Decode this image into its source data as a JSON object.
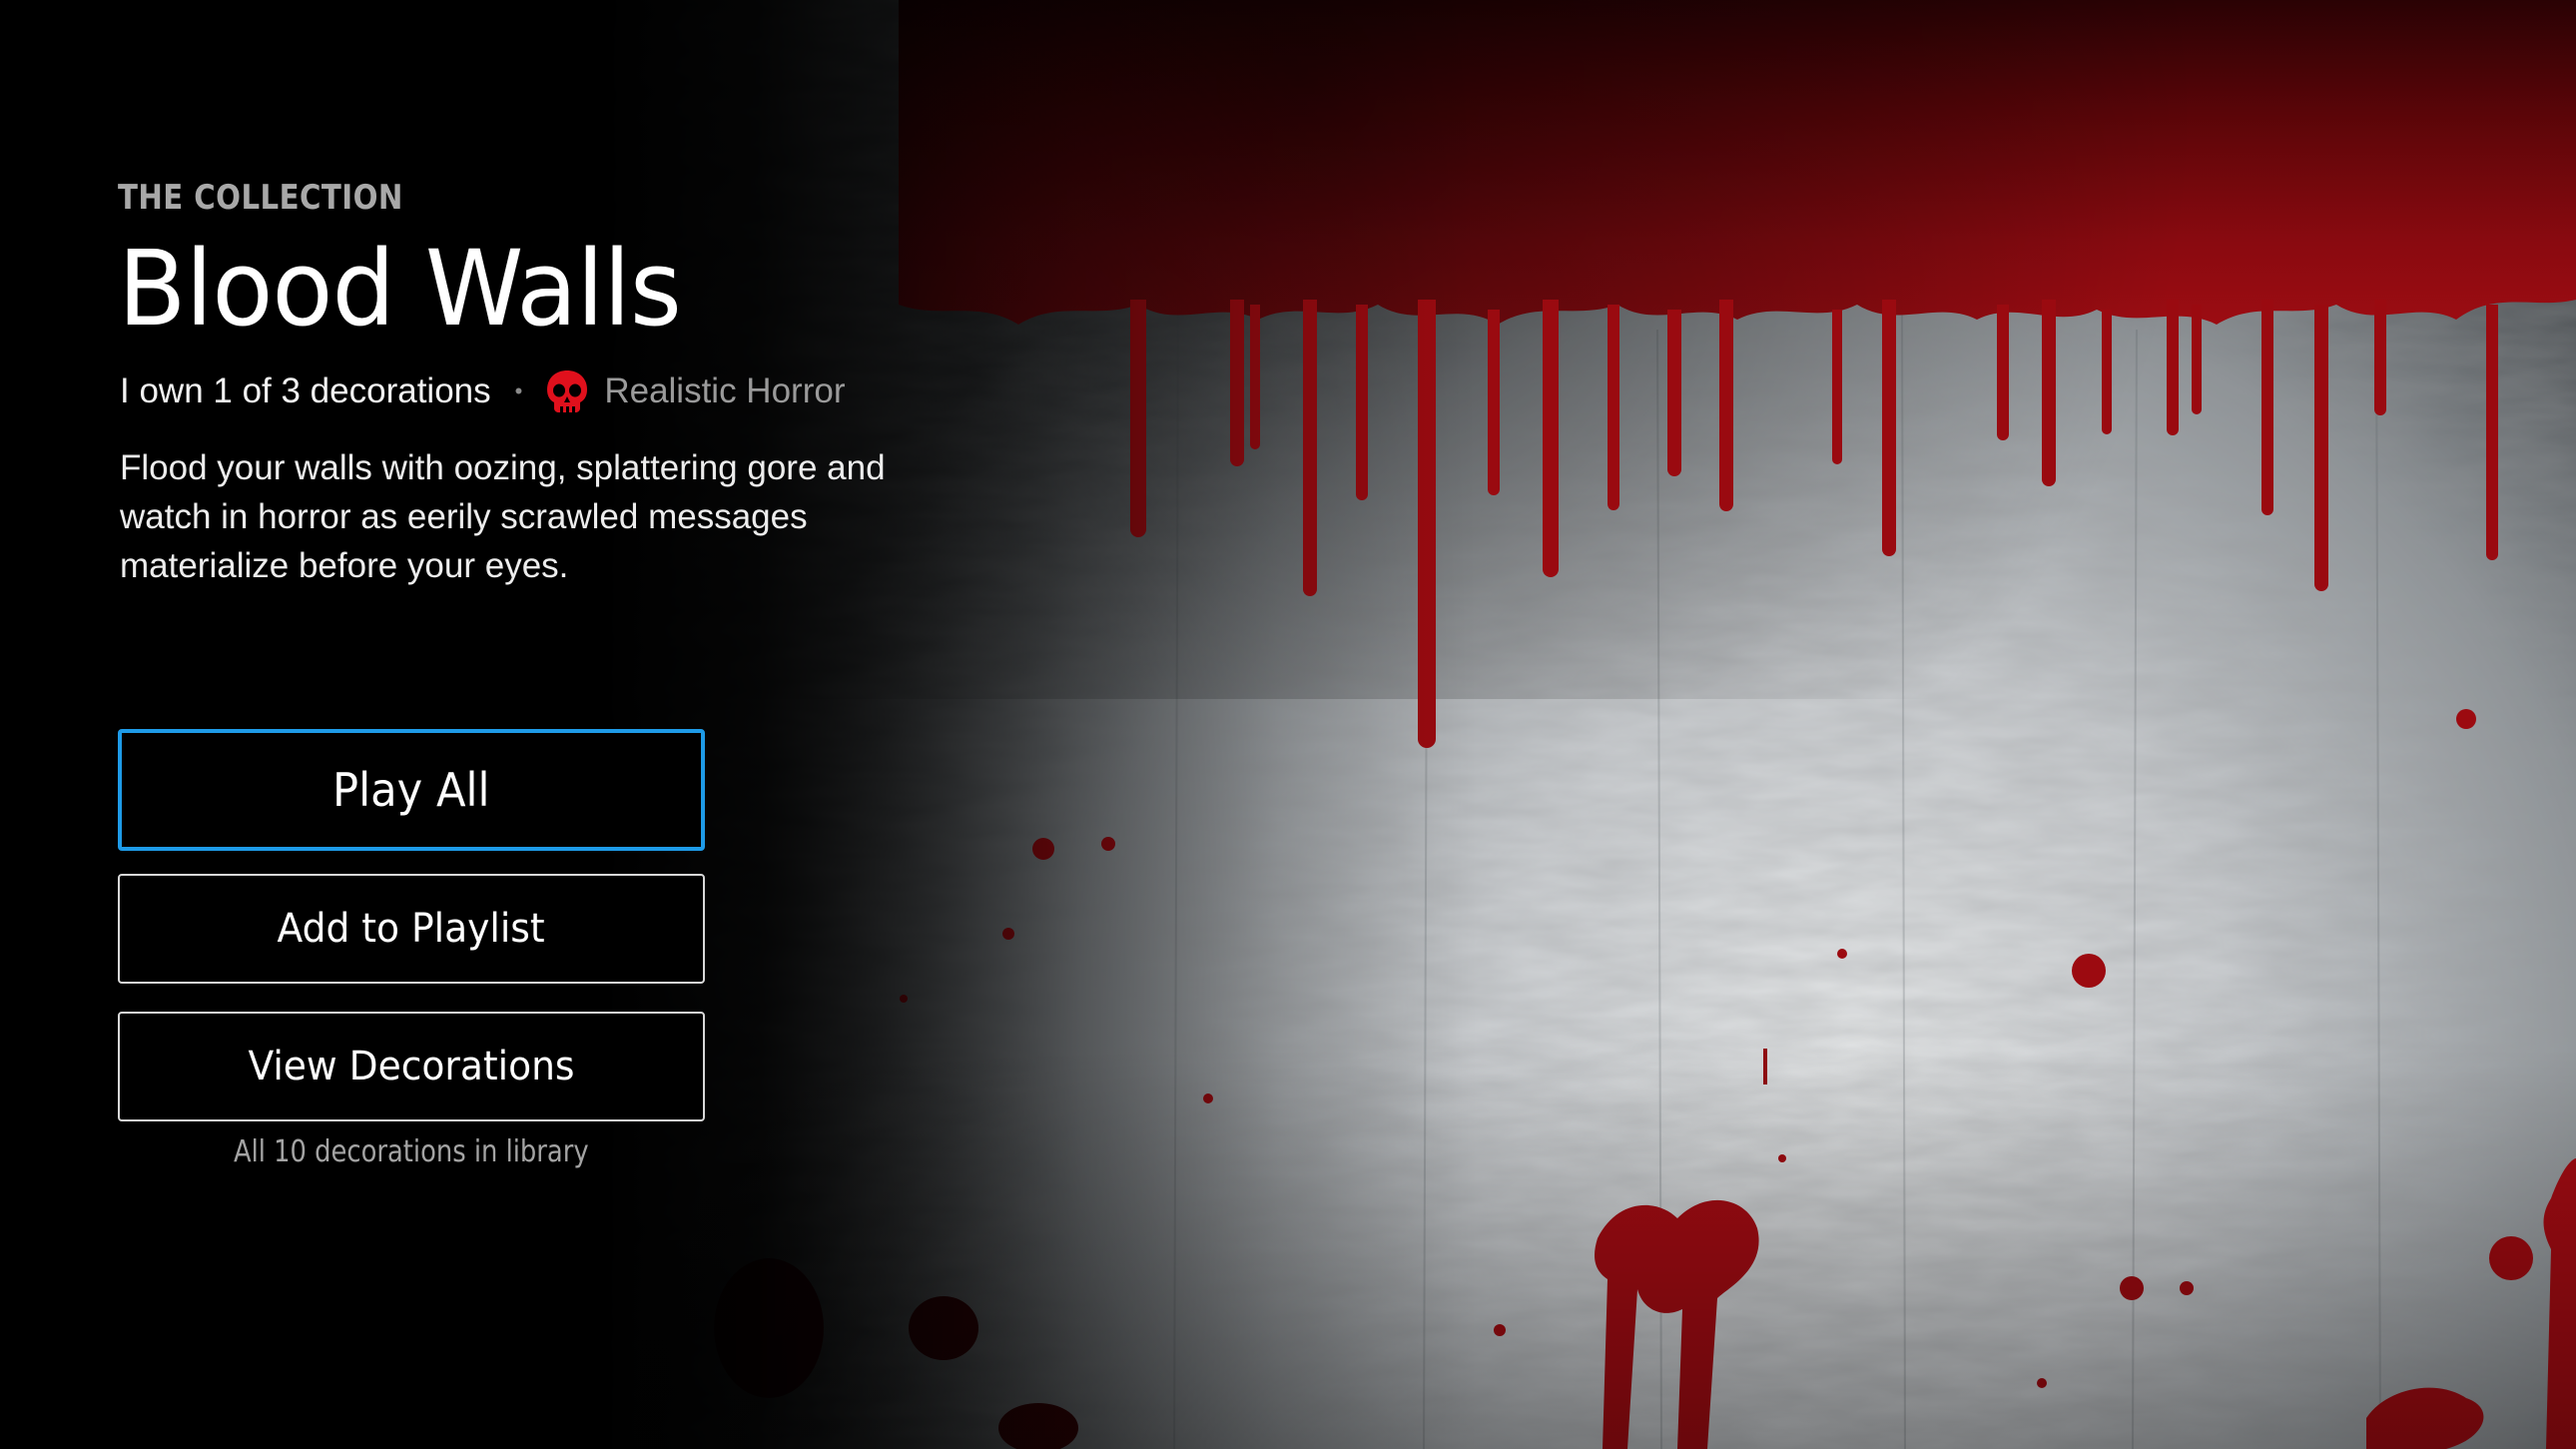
{
  "collection": {
    "eyebrow": "THE COLLECTION",
    "title": "Blood Walls",
    "ownership": "I own 1 of 3 decorations",
    "separator": "•",
    "genre": {
      "label": "Realistic Horror",
      "icon": "skull-icon",
      "icon_color": "#e0101c"
    },
    "description": "Flood your walls with oozing, splattering gore and watch in horror as eerily scrawled messages materialize before your eyes."
  },
  "actions": {
    "play_all": "Play All",
    "add_to_playlist": "Add to Playlist",
    "view_decorations": "View Decorations",
    "library_note": "All 10 decorations in library"
  },
  "theme": {
    "focus_color": "#1e9be8",
    "blood_color": "#9e0a10",
    "wall_color": "#c9ccce"
  }
}
